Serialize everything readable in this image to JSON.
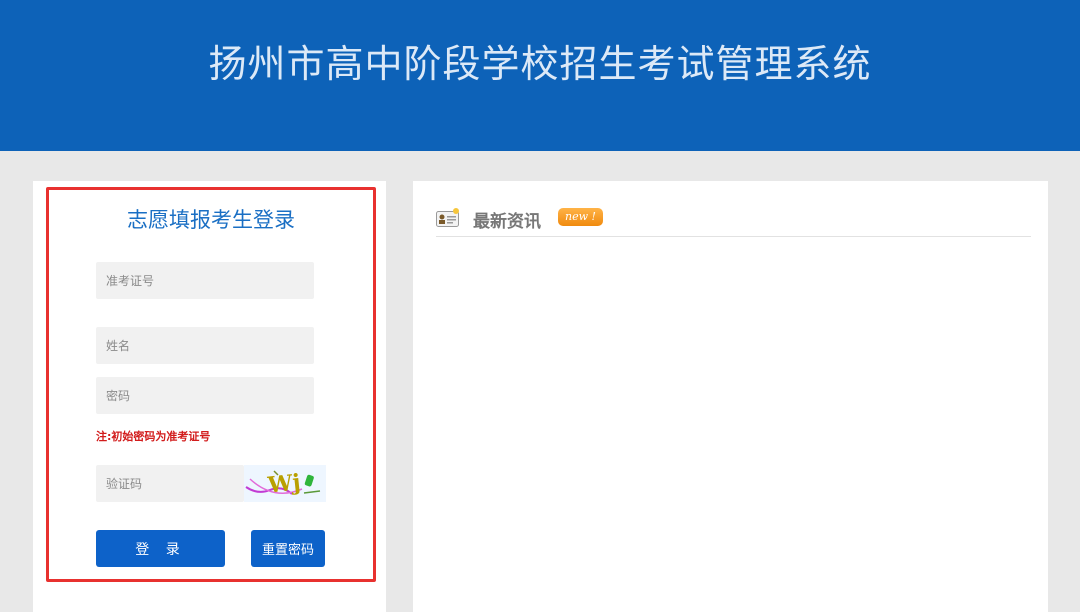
{
  "header": {
    "title": "扬州市高中阶段学校招生考试管理系统"
  },
  "login": {
    "title": "志愿填报考生登录",
    "id_placeholder": "准考证号",
    "name_placeholder": "姓名",
    "password_placeholder": "密码",
    "note": "注:初始密码为准考证号",
    "captcha_placeholder": "验证码",
    "captcha_text": "Wj",
    "login_label": "登 录",
    "reset_label": "重置密码"
  },
  "news": {
    "title": "最新资讯",
    "badge": "new !"
  },
  "colors": {
    "header_bg": "#0d62b8",
    "accent_blue": "#0d62c9",
    "highlight_border": "#e8312f",
    "note_red": "#d21c1c",
    "badge_orange": "#f08a0e"
  }
}
